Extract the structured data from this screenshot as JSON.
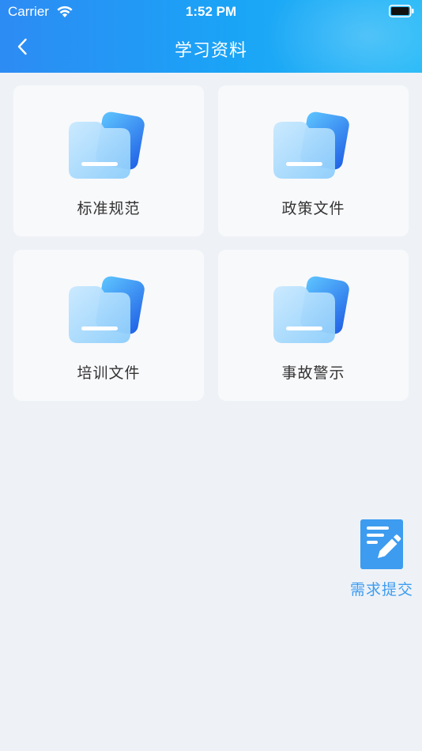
{
  "status_bar": {
    "carrier": "Carrier",
    "time": "1:52 PM"
  },
  "nav": {
    "title": "学习资料",
    "back_icon": "chevron-left-icon"
  },
  "categories": [
    {
      "label": "标准规范",
      "icon": "folder-icon"
    },
    {
      "label": "政策文件",
      "icon": "folder-icon"
    },
    {
      "label": "培训文件",
      "icon": "folder-icon"
    },
    {
      "label": "事故警示",
      "icon": "folder-icon"
    }
  ],
  "fab": {
    "label": "需求提交",
    "icon": "edit-document-icon"
  },
  "colors": {
    "header_start": "#2d8bf4",
    "header_end": "#22b8f7",
    "background": "#eef2f7",
    "card": "#f8f9fb",
    "accent": "#3d9cf0",
    "label": "#333333"
  }
}
